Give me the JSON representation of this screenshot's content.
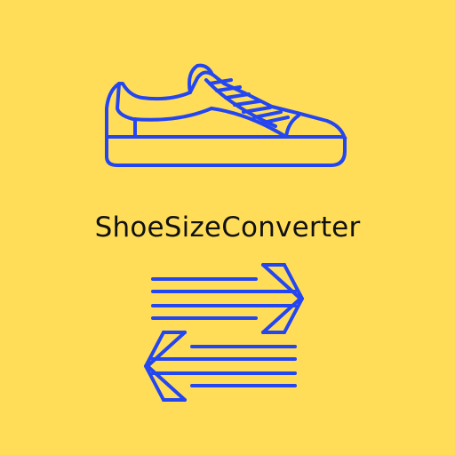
{
  "app": {
    "title": "ShoeSizeConverter"
  },
  "icons": {
    "shoe": "sneaker-icon",
    "arrows": "swap-arrows-icon"
  },
  "colors": {
    "background": "#FFDD59",
    "icon_stroke": "#2446F0",
    "title_text": "#111111"
  }
}
